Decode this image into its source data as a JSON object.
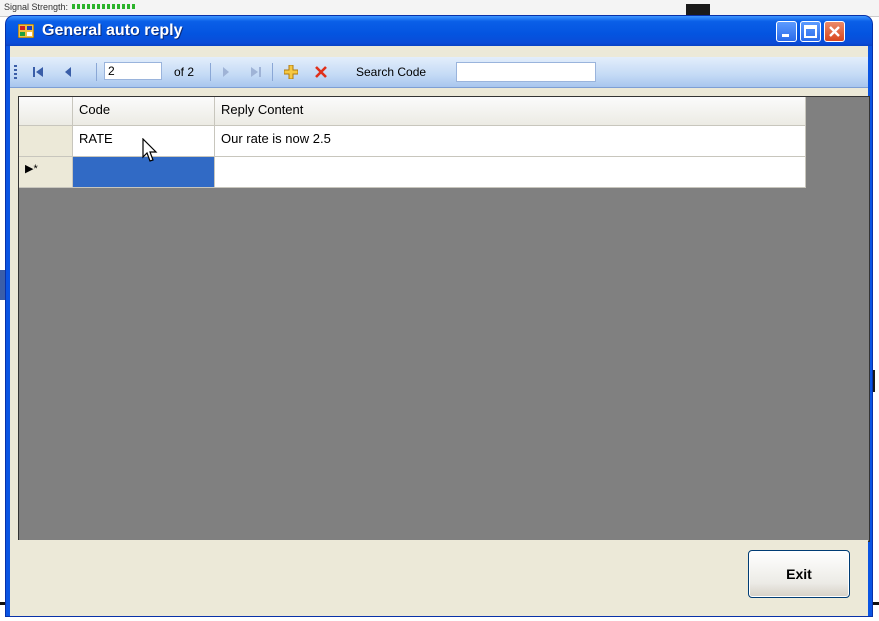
{
  "background": {
    "top_left_text": "Signal Strength:"
  },
  "window": {
    "title": "General auto reply",
    "controls": [
      "minimize",
      "maximize",
      "close"
    ]
  },
  "toolbar": {
    "position_value": "2",
    "of_label": "of 2",
    "search_label": "Search Code",
    "search_value": "",
    "icons": [
      "move-first-icon",
      "move-previous-icon",
      "move-next-icon",
      "move-last-icon",
      "add-new-icon",
      "delete-icon"
    ]
  },
  "grid": {
    "columns": [
      "Code",
      "Reply Content"
    ],
    "rows": [
      {
        "code": "RATE",
        "reply": "Our rate is now 2.5"
      },
      {
        "code": "",
        "reply": ""
      }
    ],
    "new_row_marker": "▶*"
  },
  "footer": {
    "exit_label": "Exit"
  },
  "colors": {
    "titlebar": "#0454e0",
    "selection": "#316ac5",
    "grid_background": "#808080"
  }
}
